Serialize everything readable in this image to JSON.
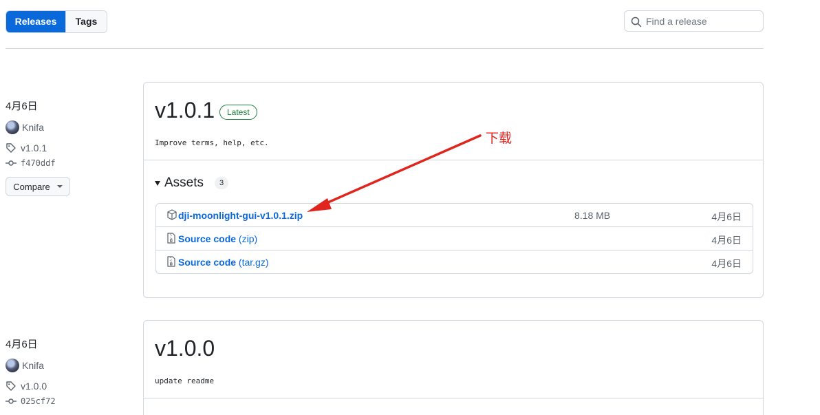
{
  "tabs": [
    {
      "label": "Releases",
      "active": true
    },
    {
      "label": "Tags",
      "active": false
    }
  ],
  "search": {
    "placeholder": "Find a release",
    "value": ""
  },
  "releases": [
    {
      "date": "4月6日",
      "author": "Knifa",
      "tag": "v1.0.1",
      "commit": "f470ddf",
      "compare_label": "Compare",
      "title": "v1.0.1",
      "badge": "Latest",
      "notes": "Improve terms, help, etc.",
      "assets_label": "Assets",
      "assets_count": "3",
      "assets": [
        {
          "name": "dji-moonlight-gui-v1.0.1.zip",
          "suffix": "",
          "size": "8.18 MB",
          "date": "4月6日",
          "icon": "package-icon"
        },
        {
          "name": "Source code",
          "suffix": " (zip)",
          "size": "",
          "date": "4月6日",
          "icon": "file-zip-icon"
        },
        {
          "name": "Source code",
          "suffix": " (tar.gz)",
          "size": "",
          "date": "4月6日",
          "icon": "file-zip-icon"
        }
      ]
    },
    {
      "date": "4月6日",
      "author": "Knifa",
      "tag": "v1.0.0",
      "commit": "025cf72",
      "title": "v1.0.0",
      "notes": "update readme"
    }
  ],
  "annotation": {
    "label": "下载",
    "color": "#e0251f"
  },
  "colors": {
    "accent": "#0969da",
    "latest": "#1a7f37",
    "border": "#d0d7de"
  }
}
